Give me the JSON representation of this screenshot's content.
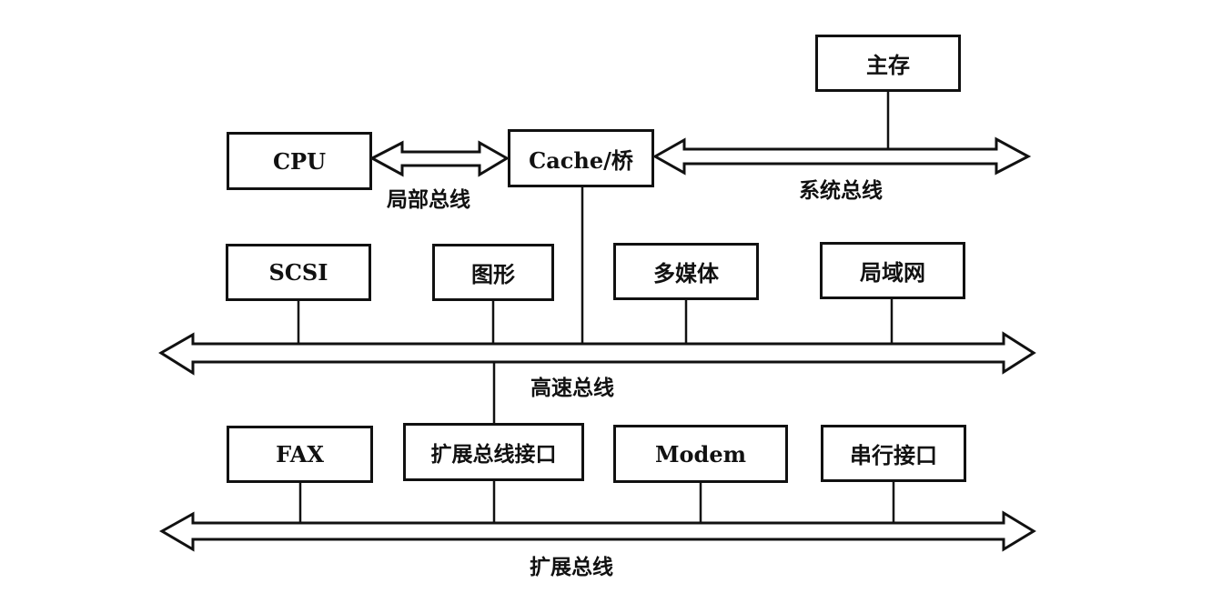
{
  "diagram": {
    "nodes": {
      "main_memory": "主存",
      "cpu": "CPU",
      "cache_bridge": "Cache/桥",
      "scsi": "SCSI",
      "graphics": "图形",
      "multimedia": "多媒体",
      "lan": "局域网",
      "fax": "FAX",
      "expansion_bus_interface": "扩展总线接口",
      "modem": "Modem",
      "serial_interface": "串行接口"
    },
    "buses": {
      "local_bus": "局部总线",
      "system_bus": "系统总线",
      "high_speed_bus": "高速总线",
      "expansion_bus": "扩展总线"
    },
    "connections": [
      {
        "from": "cpu",
        "to": "cache_bridge",
        "via": "local_bus",
        "bidirectional": true
      },
      {
        "from": "cache_bridge",
        "to": "system_bus"
      },
      {
        "from": "main_memory",
        "to": "system_bus"
      },
      {
        "from": "cache_bridge",
        "to": "high_speed_bus"
      },
      {
        "from": "scsi",
        "to": "high_speed_bus"
      },
      {
        "from": "graphics",
        "to": "high_speed_bus"
      },
      {
        "from": "multimedia",
        "to": "high_speed_bus"
      },
      {
        "from": "lan",
        "to": "high_speed_bus"
      },
      {
        "from": "high_speed_bus",
        "to": "expansion_bus_interface"
      },
      {
        "from": "fax",
        "to": "expansion_bus"
      },
      {
        "from": "expansion_bus_interface",
        "to": "expansion_bus"
      },
      {
        "from": "modem",
        "to": "expansion_bus"
      },
      {
        "from": "serial_interface",
        "to": "expansion_bus"
      }
    ]
  }
}
